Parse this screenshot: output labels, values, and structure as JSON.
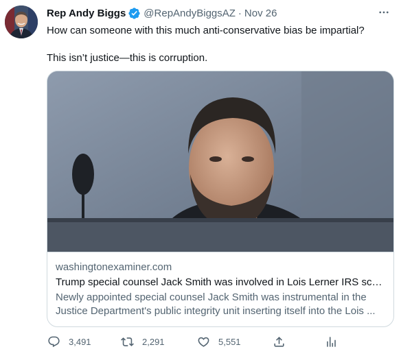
{
  "author": {
    "display_name": "Rep Andy Biggs",
    "handle": "@RepAndyBiggsAZ",
    "separator": "·",
    "date": "Nov 26"
  },
  "tweet_text": [
    "How can someone with this much anti-conservative bias be impartial?",
    "This isn’t justice—this is corruption."
  ],
  "card": {
    "domain": "washingtonexaminer.com",
    "title": "Trump special counsel Jack Smith was involved in Lois Lerner IRS scan...",
    "description_line1": "Newly appointed special counsel Jack Smith was instrumental in the",
    "description_line2": "Justice Department's public integrity unit inserting itself into the Lois ..."
  },
  "actions": {
    "reply_count": "3,491",
    "retweet_count": "2,291",
    "like_count": "5,551"
  },
  "icons": {
    "verified": "verified-badge-icon",
    "more": "more-options-icon",
    "reply": "reply-icon",
    "retweet": "retweet-icon",
    "like": "heart-icon",
    "share": "share-icon",
    "analytics": "analytics-icon"
  },
  "colors": {
    "text_primary": "#0f1419",
    "text_secondary": "#536471",
    "verified_blue": "#1d9bf0",
    "border": "#cfd9de"
  }
}
